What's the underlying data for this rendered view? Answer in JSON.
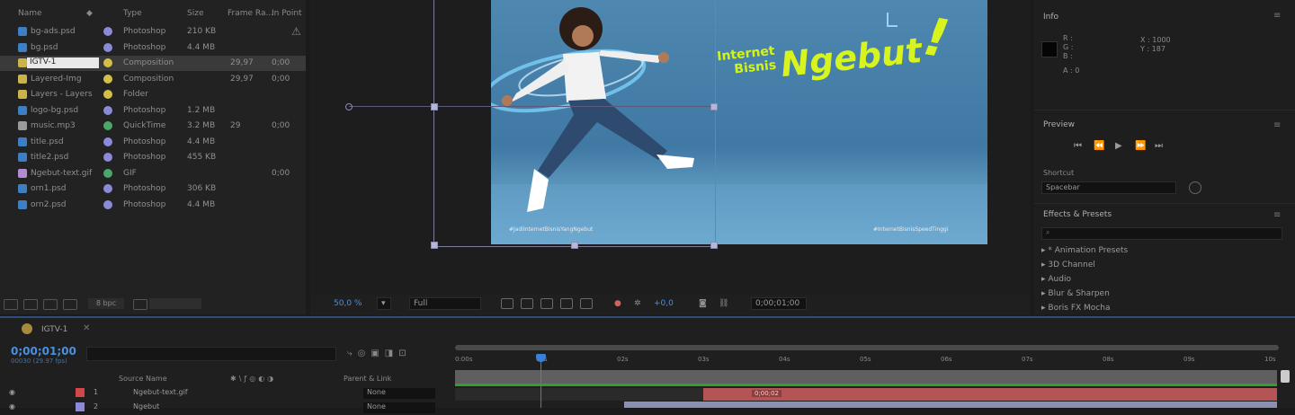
{
  "project": {
    "columns": {
      "name": "Name",
      "type": "Type",
      "size": "Size",
      "frame_rate": "Frame Ra...",
      "in_point": "In Point"
    },
    "items": [
      {
        "name": "bg-ads.psd",
        "type": "Photoshop",
        "size": "210 KB",
        "frame_rate": "",
        "in_point": "",
        "icon_color": "#3d7fc4",
        "label_color": "#8a8ad8"
      },
      {
        "name": "bg.psd",
        "type": "Photoshop",
        "size": "4.4 MB",
        "frame_rate": "",
        "in_point": "",
        "icon_color": "#3d7fc4",
        "label_color": "#8a8ad8"
      },
      {
        "name": "IGTV-1",
        "type": "Composition",
        "size": "",
        "frame_rate": "29,97",
        "in_point": "0;00",
        "icon_color": "#c9b34a",
        "label_color": "#d4c048",
        "selected": true
      },
      {
        "name": "Layered-Img",
        "type": "Composition",
        "size": "",
        "frame_rate": "29,97",
        "in_point": "0;00",
        "icon_color": "#c9b34a",
        "label_color": "#d4c048"
      },
      {
        "name": "Layers - Layers",
        "type": "Folder",
        "size": "",
        "frame_rate": "",
        "in_point": "",
        "icon_color": "#c9b34a",
        "label_color": "#d4c048"
      },
      {
        "name": "logo-bg.psd",
        "type": "Photoshop",
        "size": "1.2 MB",
        "frame_rate": "",
        "in_point": "",
        "icon_color": "#3d7fc4",
        "label_color": "#8a8ad8"
      },
      {
        "name": "music.mp3",
        "type": "QuickTime",
        "size": "3.2 MB",
        "frame_rate": "29",
        "in_point": "0;00",
        "icon_color": "#9a9a9a",
        "label_color": "#4aa868"
      },
      {
        "name": "title.psd",
        "type": "Photoshop",
        "size": "4.4 MB",
        "frame_rate": "",
        "in_point": "",
        "icon_color": "#3d7fc4",
        "label_color": "#8a8ad8"
      },
      {
        "name": "title2.psd",
        "type": "Photoshop",
        "size": "455 KB",
        "frame_rate": "",
        "in_point": "",
        "icon_color": "#3d7fc4",
        "label_color": "#8a8ad8"
      },
      {
        "name": "Ngebut-text.gif",
        "type": "GIF",
        "size": "",
        "frame_rate": "",
        "in_point": "0;00",
        "icon_color": "#b48ad0",
        "label_color": "#4aa868"
      },
      {
        "name": "orn1.psd",
        "type": "Photoshop",
        "size": "306 KB",
        "frame_rate": "",
        "in_point": "",
        "icon_color": "#3d7fc4",
        "label_color": "#8a8ad8"
      },
      {
        "name": "orn2.psd",
        "type": "Photoshop",
        "size": "4.4 MB",
        "frame_rate": "",
        "in_point": "",
        "icon_color": "#3d7fc4",
        "label_color": "#8a8ad8"
      }
    ],
    "footer": {
      "bpc": "8 bpc"
    }
  },
  "viewer": {
    "headline_small": "Internet\nBisnis",
    "headline_big": "Ngebut",
    "exclaim": "!",
    "hashtag_left": "#JadiInternetBisnisYangNgebut",
    "hashtag_right": "#InternetBisnisSpeedTinggi",
    "toolbar": {
      "zoom": "50,0 %",
      "resolution": "Full",
      "exposure": "+0,0",
      "timecode": "0;00;01;00"
    }
  },
  "right": {
    "info": {
      "title": "Info",
      "lines": [
        "R :",
        "G :",
        "B :",
        "A : 0"
      ],
      "x": "X : 1000",
      "y": "Y : 187"
    },
    "preview": {
      "title": "Preview",
      "shortcut_label": "Shortcut",
      "shortcut_value": "Spacebar"
    },
    "effects": {
      "title": "Effects & Presets",
      "search_placeholder": "",
      "items": [
        "* Animation Presets",
        "3D Channel",
        "Audio",
        "Blur & Sharpen",
        "Boris FX Mocha"
      ]
    }
  },
  "timeline": {
    "tab": "IGTV-1",
    "timecode": "0;00;01;00",
    "fps": "00030 (29.97 fps)",
    "columns": {
      "source": "Source Name",
      "parent": "Parent & Link"
    },
    "layers": [
      {
        "num": "1",
        "name": "Ngebut-text.gif",
        "parent": "None",
        "color": "#d04848"
      },
      {
        "num": "2",
        "name": "Ngebut",
        "parent": "None",
        "color": "#8a8ad8"
      }
    ],
    "ruler_labels": [
      "0:00s",
      "01s",
      "02s",
      "03s",
      "04s",
      "05s",
      "06s",
      "07s",
      "08s",
      "09s",
      "10s"
    ],
    "bar_label": "0;00;02"
  }
}
